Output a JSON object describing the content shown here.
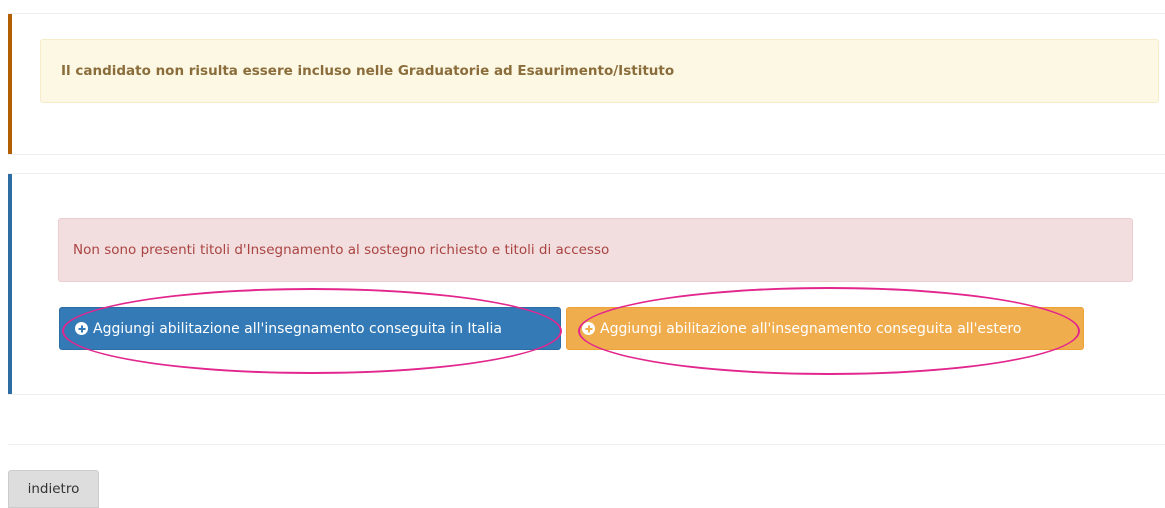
{
  "warning_panel": {
    "message": "Il candidato non risulta essere incluso nelle Graduatorie ad Esaurimento/Istituto"
  },
  "titles_panel": {
    "message": "Non sono presenti titoli d'Insegnamento al sostegno richiesto e titoli di accesso",
    "add_italy_button": "Aggiungi abilitazione all'insegnamento conseguita in Italia",
    "add_abroad_button": "Aggiungi abilitazione all'insegnamento conseguita all'estero"
  },
  "footer": {
    "back_button": "indietro"
  },
  "icons": {
    "add": "plus-circle-icon"
  },
  "colors": {
    "warning_accent": "#b35f00",
    "info_accent": "#2e6da4",
    "primary": "#337ab7",
    "warning": "#f0ad4e",
    "annotation": "#e2268e"
  }
}
